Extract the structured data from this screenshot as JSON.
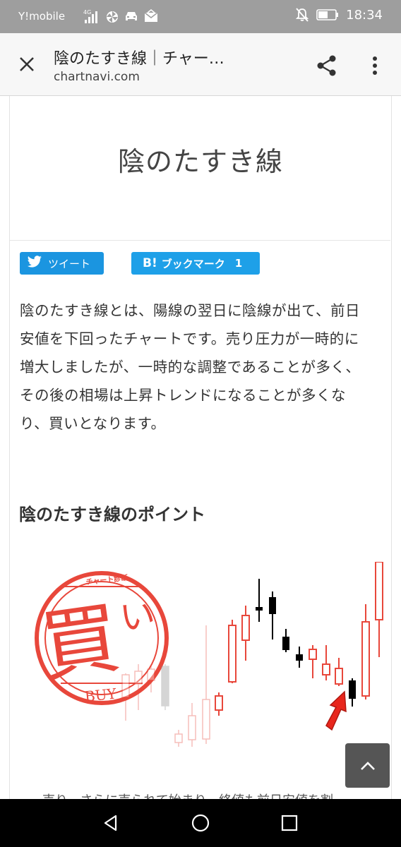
{
  "status_bar": {
    "carrier": "Y!mobile",
    "network": "4G",
    "time": "18:34",
    "icons": [
      "signal-icon",
      "pinwheel-icon",
      "car-icon",
      "mail-icon",
      "mute-icon",
      "battery-icon"
    ]
  },
  "toolbar": {
    "title": "陰のたすき線｜チャー…",
    "url": "chartnavi.com",
    "icons": [
      "close-icon",
      "share-icon",
      "more-vert-icon"
    ]
  },
  "article": {
    "title": "陰のたすき線",
    "tweet_label": "ツイート",
    "hatena_logo": "B!",
    "hatena_label": "ブックマーク",
    "hatena_count": "1",
    "body_lines": [
      "陰のたすき線とは、陽線の翌日に陰線が出て、前日",
      "安値を下回ったチャートです。売り圧力が一時的に",
      "増大しましたが、一時的な調整であることが多く、",
      "その後の相場は上昇トレンドになることが多くな",
      "り、買いとなります。"
    ],
    "section_heading": "陰のたすき線のポイント",
    "stamp": {
      "top_text": "チャート診断",
      "main_char": "買",
      "side_char": "い",
      "bottom_text": "BUY",
      "color": "#e8473b"
    },
    "caption_partial": "売り、さらに売られて始まり、終値も前日安値を割"
  },
  "colors": {
    "accent_twitter": "#1b95e0",
    "accent_hatena": "#1ea0e8",
    "candle_red": "#e8473b",
    "candle_black": "#000000",
    "arrow_red": "#e8261c"
  },
  "navbar": {
    "icons": [
      "back-icon",
      "home-icon",
      "recents-icon"
    ]
  }
}
